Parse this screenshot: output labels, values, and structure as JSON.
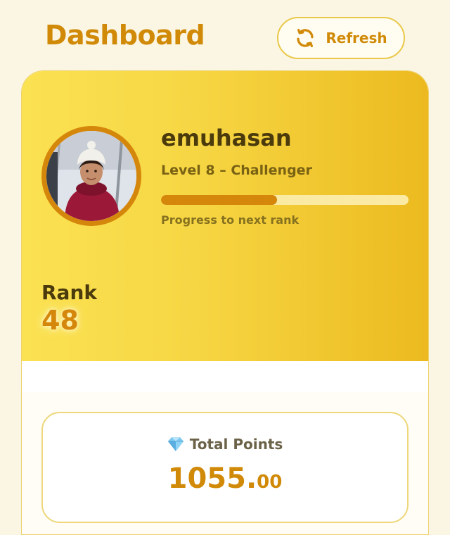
{
  "header": {
    "title": "Dashboard",
    "refresh_label": "Refresh",
    "refresh_icon": "refresh-icon"
  },
  "profile": {
    "username": "emuhasan",
    "level": "Level 8 – Challenger",
    "progress_fraction": 0.47,
    "progress_caption": "Progress to next rank",
    "rank_label": "Rank",
    "rank_value": "48"
  },
  "points": {
    "icon": "gem-icon",
    "title": "Total Points",
    "integer": "1055.",
    "decimal": "00"
  },
  "colors": {
    "accent": "#d18a08",
    "card_gradient_start": "#fbe253",
    "card_gradient_end": "#ecba1f",
    "progress_fill": "#d5870b",
    "progress_track": "#faeaa3",
    "background": "#fbf6e4"
  }
}
